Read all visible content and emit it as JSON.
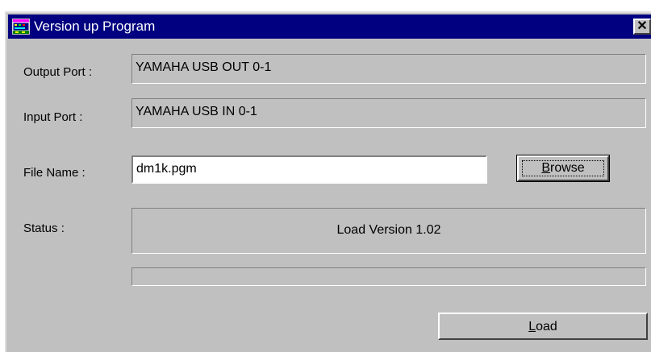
{
  "window": {
    "title": "Version up Program",
    "close_glyph": "✕",
    "icon": "app-icon",
    "titlebar_color": "#000080",
    "face_color": "#c0c0c0"
  },
  "form": {
    "output_port": {
      "label": "Output Port :",
      "value": "YAMAHA USB OUT 0-1"
    },
    "input_port": {
      "label": "Input Port :",
      "value": "YAMAHA USB IN 0-1"
    },
    "file_name": {
      "label": "File Name :",
      "value": "dm1k.pgm"
    },
    "browse_button": {
      "label": "Browse"
    },
    "status": {
      "label": "Status :",
      "value": "Load Version 1.02"
    },
    "progress": {
      "value": 0
    },
    "load_button": {
      "label": "Load"
    }
  }
}
